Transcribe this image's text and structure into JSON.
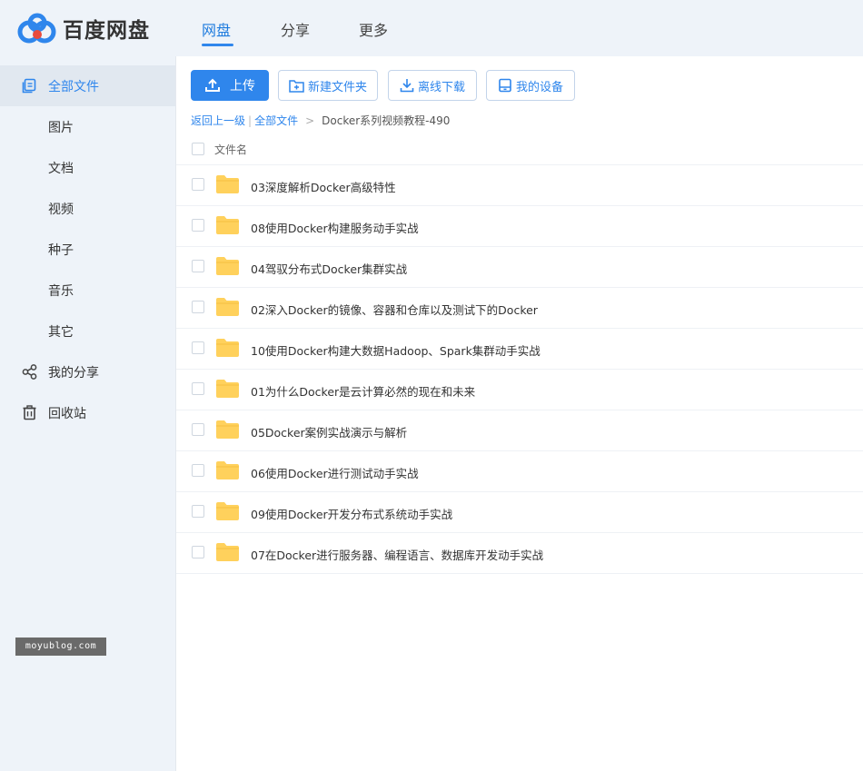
{
  "app": {
    "logo_text": "百度网盘"
  },
  "nav": {
    "tabs": [
      "网盘",
      "分享",
      "更多"
    ],
    "active": "网盘"
  },
  "sidebar": {
    "items": [
      {
        "label": "全部文件",
        "icon": "files-icon",
        "active": true
      },
      {
        "label": "图片"
      },
      {
        "label": "文档"
      },
      {
        "label": "视频"
      },
      {
        "label": "种子"
      },
      {
        "label": "音乐"
      },
      {
        "label": "其它"
      },
      {
        "label": "我的分享",
        "icon": "share-icon"
      },
      {
        "label": "回收站",
        "icon": "trash-icon"
      }
    ]
  },
  "watermark": "moyublog.com",
  "toolbar": {
    "upload": "上传",
    "new_folder": "新建文件夹",
    "offline_download": "离线下载",
    "my_devices": "我的设备"
  },
  "breadcrumb": {
    "back": "返回上一级",
    "all_files": "全部文件",
    "current": "Docker系列视频教程-490"
  },
  "list": {
    "header": "文件名",
    "files": [
      "03深度解析Docker高级特性",
      "08使用Docker构建服务动手实战",
      "04驾驭分布式Docker集群实战",
      "02深入Docker的镜像、容器和仓库以及测试下的Docker",
      "10使用Docker构建大数据Hadoop、Spark集群动手实战",
      "01为什么Docker是云计算必然的现在和未来",
      "05Docker案例实战演示与解析",
      "06使用Docker进行测试动手实战",
      "09使用Docker开发分布式系统动手实战",
      "07在Docker进行服务器、编程语言、数据库开发动手实战"
    ]
  },
  "colors": {
    "accent": "#2f86ec",
    "folder": "#ffd15c",
    "sidebar_bg": "#eef3f9"
  }
}
